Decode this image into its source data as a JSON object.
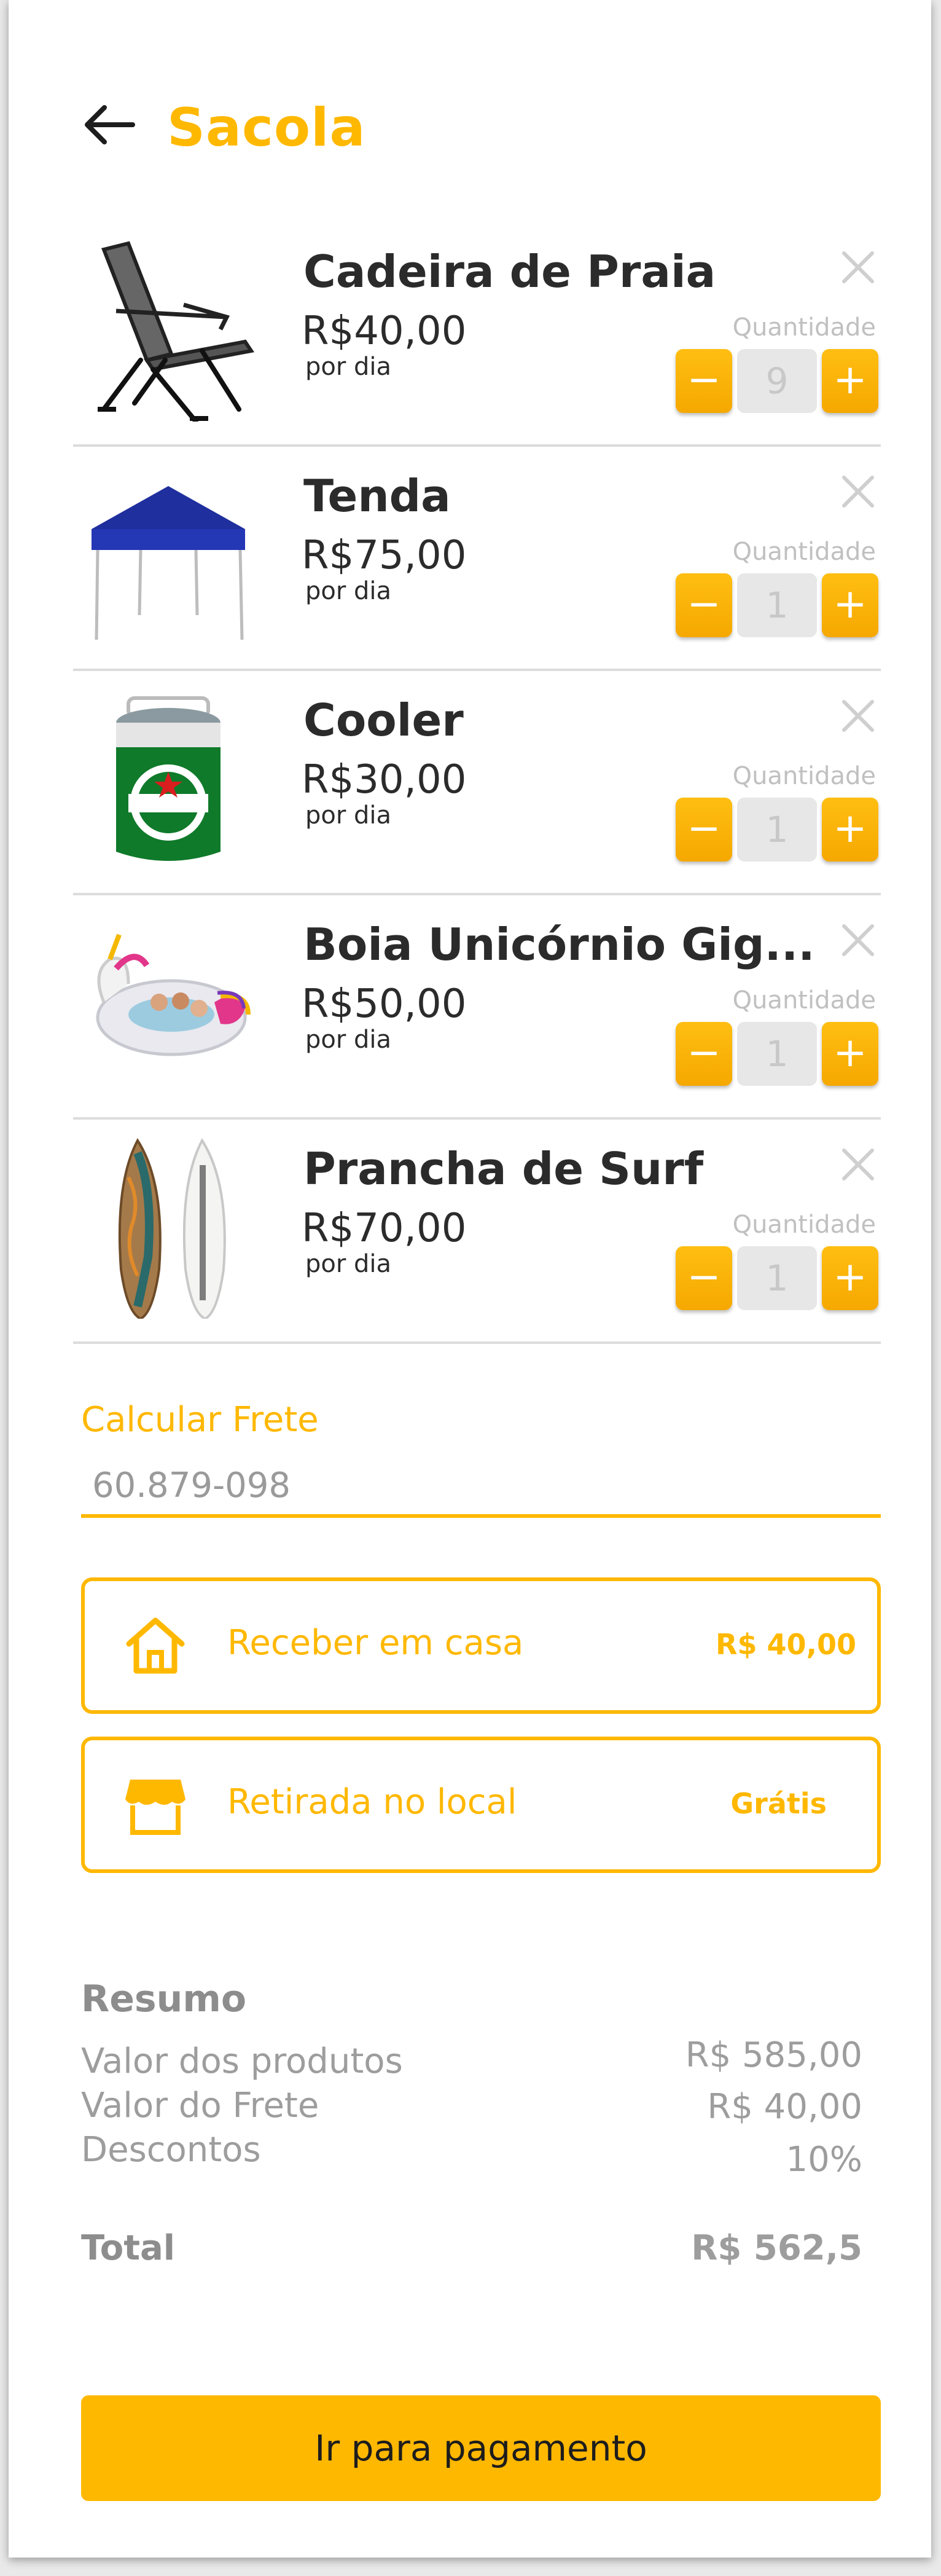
{
  "header": {
    "title": "Sacola",
    "back_icon": "arrow-left-icon"
  },
  "cart": {
    "quantity_label": "Quantidade",
    "items": [
      {
        "name": "Cadeira de Praia",
        "price": "R$40,00",
        "unit": "por dia",
        "quantity": "9",
        "image": "beach-chair"
      },
      {
        "name": "Tenda",
        "price": "R$75,00",
        "unit": "por dia",
        "quantity": "1",
        "image": "tent"
      },
      {
        "name": "Cooler",
        "price": "R$30,00",
        "unit": "por dia",
        "quantity": "1",
        "image": "cooler"
      },
      {
        "name": "Boia Unicórnio Gig...",
        "price": "R$50,00",
        "unit": "por dia",
        "quantity": "1",
        "image": "unicorn-float"
      },
      {
        "name": "Prancha de Surf",
        "price": "R$70,00",
        "unit": "por dia",
        "quantity": "1",
        "image": "surfboards"
      }
    ]
  },
  "shipping": {
    "label": "Calcular Frete",
    "cep_value": "60.879-098",
    "options": [
      {
        "label": "Receber em casa",
        "price": "R$ 40,00",
        "icon": "house-icon"
      },
      {
        "label": "Retirada no local",
        "price": "Grátis",
        "icon": "store-icon"
      }
    ]
  },
  "summary": {
    "title": "Resumo",
    "products_label": "Valor dos produtos",
    "products_value": "R$ 585,00",
    "freight_label": "Valor do Frete",
    "freight_value": "R$ 40,00",
    "discount_label": "Descontos",
    "discount_value": "10%",
    "total_label": "Total",
    "total_value": "R$ 562,5"
  },
  "checkout": {
    "button_label": "Ir para pagamento"
  },
  "colors": {
    "accent": "#FFB800",
    "text": "#2b2b2b",
    "muted": "#9d9d9d"
  }
}
